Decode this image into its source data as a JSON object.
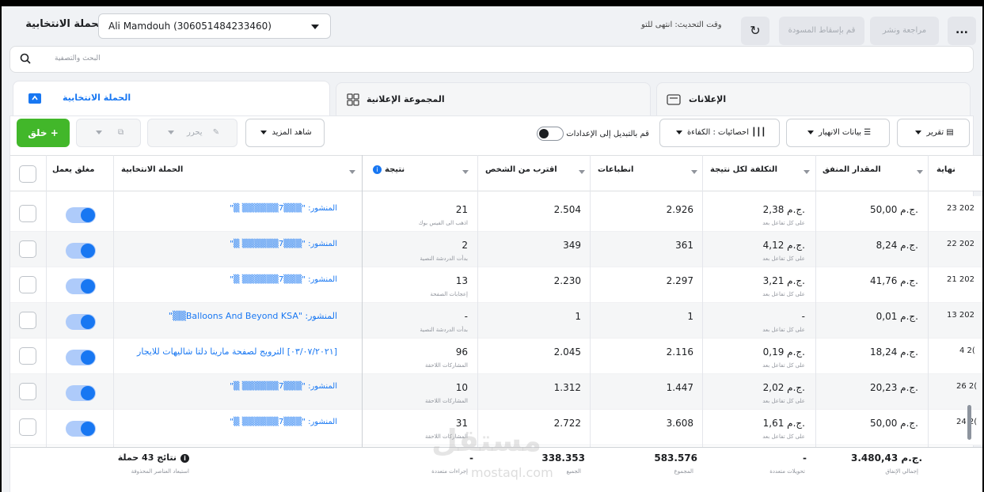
{
  "topbar": {
    "page_title": "الحملة الانتخابية",
    "account": "Ali Mamdouh (306051484233460)",
    "update_status": "وقت التحديث: انتهى للتو",
    "discard_label": "قم بإسقاط المسودة",
    "review_label": "مراجعة ونشر",
    "more_label": "..."
  },
  "search": {
    "placeholder": "البحث والتصفية"
  },
  "tabs": [
    {
      "label": "الحملة الانتخابية"
    },
    {
      "label": "المجموعة الإعلانية"
    },
    {
      "label": "الإعلانات"
    }
  ],
  "toolbar": {
    "create": "خلق +",
    "edit": "يحرر",
    "see_more": "شاهد المزيد",
    "settings_toggle": "قم بالتبديل إلى الإعدادات",
    "stats": "احصائيات : الكفاءة",
    "breakdown": "بيانات الانهيار",
    "report": "تقرير"
  },
  "columns": {
    "onoff": "مغلق يعمل",
    "campaign": "الحملة الانتخابية",
    "result": "نتيجة",
    "reach": "اقترب من الشخص",
    "impressions": "انطباعات",
    "cost": "التكلفة لكل نتيجة",
    "spent": "المقدار المنفق",
    "end": "نهاية"
  },
  "rows": [
    {
      "name": "المنشور: \"▒▒▒7▒▒▒▒▒▒ ▒\"",
      "result": "21",
      "result_sub": "اذهب الى الفيس بوك",
      "reach": "2.504",
      "impressions": "2.926",
      "cost": "2,38 ج.م.",
      "cost_sub": "على كل تفاعل بعد",
      "spent": "50,00 ج.م.",
      "end": "23 202"
    },
    {
      "name": "المنشور: \"▒▒▒7▒▒▒▒▒▒ ▒\"",
      "result": "2",
      "result_sub": "بدأت الدردشة النصية",
      "reach": "349",
      "impressions": "361",
      "cost": "4,12 ج.م.",
      "cost_sub": "على كل تفاعل بعد",
      "spent": "8,24 ج.م.",
      "end": "22 202"
    },
    {
      "name": "المنشور: \"▒▒▒7▒▒▒▒▒▒ ▒\"",
      "result": "13",
      "result_sub": "إعجابات الصفحة",
      "reach": "2.230",
      "impressions": "2.297",
      "cost": "3,21 ج.م.",
      "cost_sub": "على كل تفاعل بعد",
      "spent": "41,76 ج.م.",
      "end": "21 202"
    },
    {
      "name": "المنشور: \"Balloons And Beyond KSA▒▒\"",
      "result": "-",
      "result_sub": "بدأت الدردشة النصية",
      "reach": "1",
      "impressions": "1",
      "cost": "-",
      "cost_sub": "على كل تفاعل بعد",
      "spent": "0,01 ج.م.",
      "end": "13 202"
    },
    {
      "name": "[٠٣/٠٧/٢٠٢١] الترويج لصفحة مارينا دلتا شاليهات للايجار",
      "result": "96",
      "result_sub": "المشاركات اللاحقة",
      "reach": "2.045",
      "impressions": "2.116",
      "cost": "0,19 ج.م.",
      "cost_sub": "على كل تفاعل بعد",
      "spent": "18,24 ج.م.",
      "end": "4 2("
    },
    {
      "name": "المنشور: \"▒▒▒7▒▒▒▒▒▒ ▒\"",
      "result": "10",
      "result_sub": "المشاركات اللاحقة",
      "reach": "1.312",
      "impressions": "1.447",
      "cost": "2,02 ج.م.",
      "cost_sub": "على كل تفاعل بعد",
      "spent": "20,23 ج.م.",
      "end": "26 2("
    },
    {
      "name": "المنشور: \"▒▒▒7▒▒▒▒▒▒ ▒\"",
      "result": "31",
      "result_sub": "المشاركات اللاحقة",
      "reach": "2.722",
      "impressions": "3.608",
      "cost": "1,61 ج.م.",
      "cost_sub": "على كل تفاعل بعد",
      "spent": "50,00 ج.م.",
      "end": "24 2("
    }
  ],
  "summary": {
    "title": "نتائج 43 حملة",
    "title_sub": "استبعاد العناصر المحذوفة",
    "result": "-",
    "result_sub": "إجراءات متعددة",
    "reach": "338.353",
    "reach_sub": "الجميع",
    "impressions": "583.576",
    "impressions_sub": "المجموع",
    "cost": "-",
    "cost_sub": "تحويلات متعددة",
    "spent": "3.480,43 ج.م.",
    "spent_sub": "إجمالي الإنفاق"
  },
  "watermark": {
    "text": "مستقل",
    "domain": "mostaql.com"
  },
  "colors": {
    "accent": "#1877f2",
    "create": "#42b72a"
  }
}
